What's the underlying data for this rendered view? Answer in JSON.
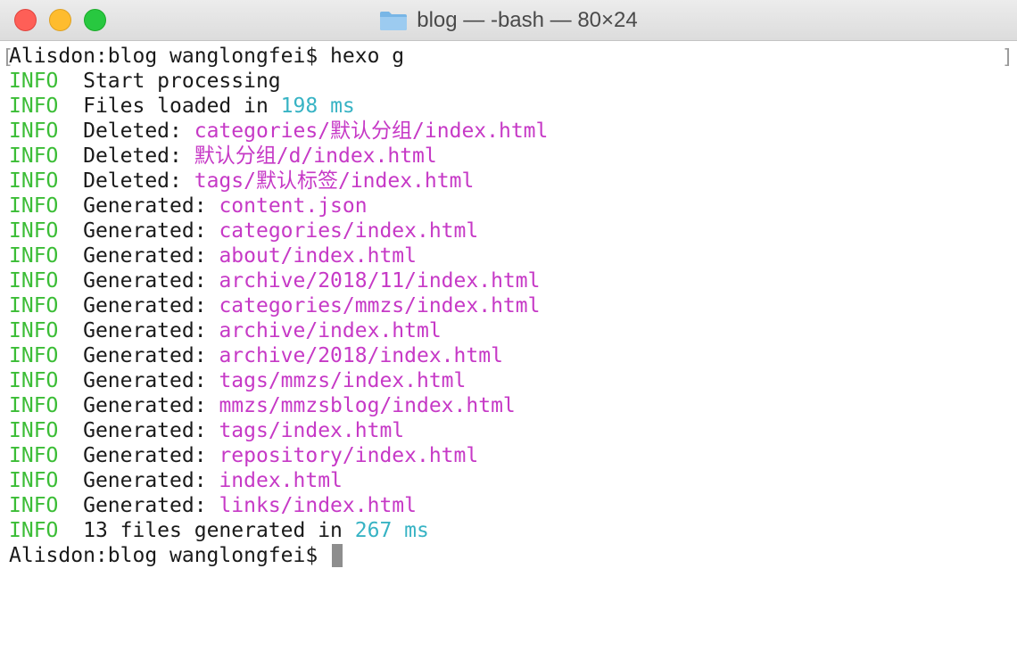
{
  "window": {
    "title": "blog — -bash — 80×24"
  },
  "terminal": {
    "prompt": "Alisdon:blog wanglongfei$",
    "command": "hexo g",
    "info_tag": "INFO",
    "lines": [
      {
        "text": "Start processing"
      },
      {
        "text": "Files loaded in",
        "num": "198",
        "unit": "ms"
      },
      {
        "text": "Deleted:",
        "path": "categories/默认分组/index.html"
      },
      {
        "text": "Deleted:",
        "path": "默认分组/d/index.html"
      },
      {
        "text": "Deleted:",
        "path": "tags/默认标签/index.html"
      },
      {
        "text": "Generated:",
        "path": "content.json"
      },
      {
        "text": "Generated:",
        "path": "categories/index.html"
      },
      {
        "text": "Generated:",
        "path": "about/index.html"
      },
      {
        "text": "Generated:",
        "path": "archive/2018/11/index.html"
      },
      {
        "text": "Generated:",
        "path": "categories/mmzs/index.html"
      },
      {
        "text": "Generated:",
        "path": "archive/index.html"
      },
      {
        "text": "Generated:",
        "path": "archive/2018/index.html"
      },
      {
        "text": "Generated:",
        "path": "tags/mmzs/index.html"
      },
      {
        "text": "Generated:",
        "path": "mmzs/mmzsblog/index.html"
      },
      {
        "text": "Generated:",
        "path": "tags/index.html"
      },
      {
        "text": "Generated:",
        "path": "repository/index.html"
      },
      {
        "text": "Generated:",
        "path": "index.html"
      },
      {
        "text": "Generated:",
        "path": "links/index.html"
      },
      {
        "text": "13 files generated in",
        "num": "267",
        "unit": "ms"
      }
    ]
  },
  "colors": {
    "info": "#3bbd36",
    "number": "#37b3c4",
    "path": "#c639c6",
    "text": "#1a1a1a"
  }
}
